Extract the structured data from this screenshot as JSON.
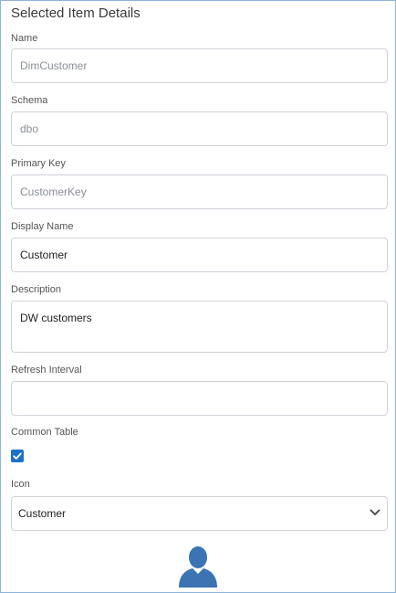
{
  "panel": {
    "title": "Selected Item Details"
  },
  "fields": {
    "name": {
      "label": "Name",
      "value": "DimCustomer"
    },
    "schema": {
      "label": "Schema",
      "value": "dbo"
    },
    "primary_key": {
      "label": "Primary Key",
      "value": "CustomerKey"
    },
    "display_name": {
      "label": "Display Name",
      "value": "Customer"
    },
    "description": {
      "label": "Description",
      "value": "DW customers"
    },
    "refresh_interval": {
      "label": "Refresh Interval",
      "value": ""
    },
    "common_table": {
      "label": "Common Table",
      "checked": true
    },
    "icon": {
      "label": "Icon",
      "selected": "Customer",
      "preview_icon": "person-icon"
    }
  },
  "colors": {
    "accent": "#1a73c9",
    "avatar": "#3b73b3",
    "border": "#8fb3d9"
  }
}
